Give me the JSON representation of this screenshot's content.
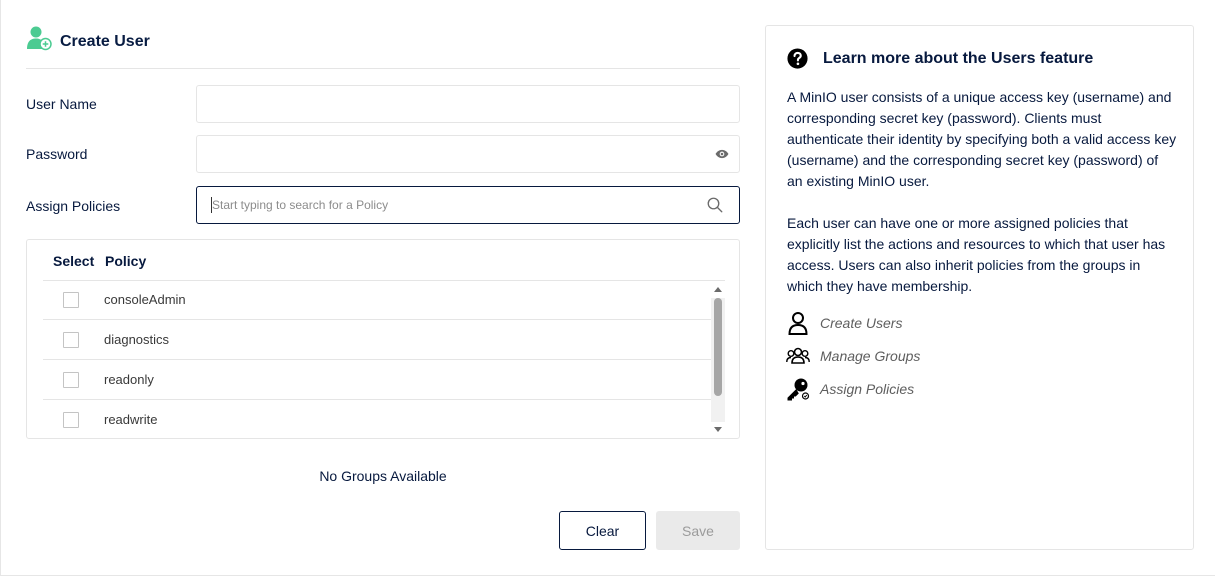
{
  "header": {
    "title": "Create User",
    "icon": "add-user-icon",
    "icon_color": "#4ccb92"
  },
  "form": {
    "username": {
      "label": "User Name",
      "value": ""
    },
    "password": {
      "label": "Password",
      "value": "",
      "icon": "eye-icon"
    },
    "policies": {
      "label": "Assign Policies",
      "placeholder": "Start typing to search for a Policy",
      "icon": "search-icon"
    }
  },
  "policy_table": {
    "columns": [
      "Select",
      "Policy"
    ],
    "rows": [
      {
        "name": "consoleAdmin",
        "checked": false
      },
      {
        "name": "diagnostics",
        "checked": false
      },
      {
        "name": "readonly",
        "checked": false
      },
      {
        "name": "readwrite",
        "checked": false
      }
    ]
  },
  "groups": {
    "empty_text": "No Groups Available"
  },
  "buttons": {
    "clear": "Clear",
    "save": "Save"
  },
  "help": {
    "icon": "question-circle-icon",
    "title": "Learn more about the Users feature",
    "paragraph1": "A MinIO user consists of a unique access key (username) and corresponding secret key (password). Clients must authenticate their identity by specifying both a valid access key (username) and the corresponding secret key (password) of an existing MinIO user.",
    "paragraph2": "Each user can have one or more assigned policies that explicitly list the actions and resources to which that user has access. Users can also inherit policies from the groups in which they have membership.",
    "links": [
      {
        "label": "Create Users",
        "icon": "user-icon"
      },
      {
        "label": "Manage Groups",
        "icon": "users-group-icon"
      },
      {
        "label": "Assign Policies",
        "icon": "key-icon"
      }
    ]
  },
  "colors": {
    "accent": "#4ccb92",
    "text": "#07193e",
    "border": "#e5e5e5",
    "save_bg": "#eaeaea"
  }
}
